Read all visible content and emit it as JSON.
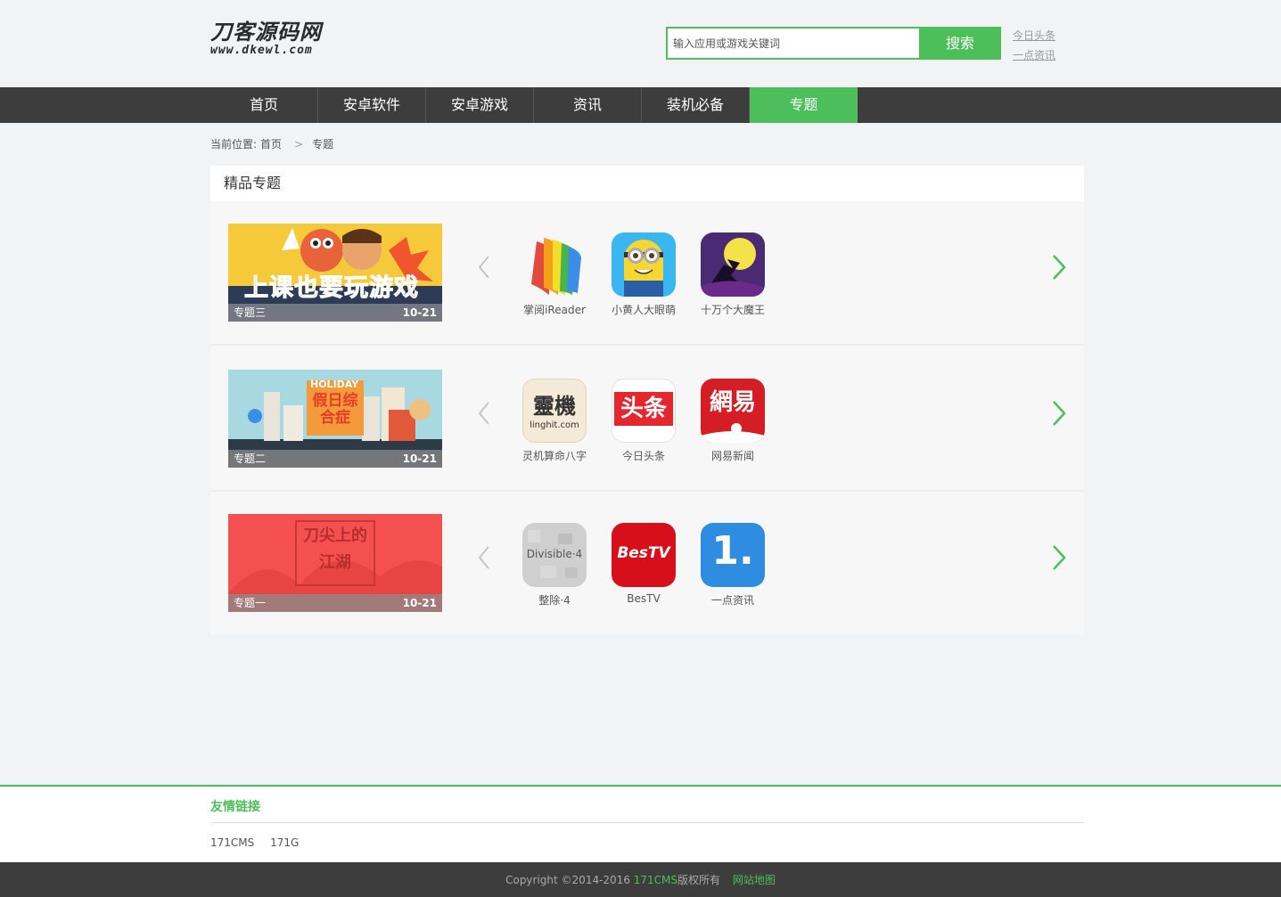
{
  "header": {
    "logo_text": "刀客源码网",
    "logo_url_text": "www.dkewl.com",
    "search_placeholder": "输入应用或游戏关键词",
    "search_button": "搜索",
    "hot_links": [
      "今日头条",
      "一点资讯"
    ]
  },
  "nav": {
    "items": [
      "首页",
      "安卓软件",
      "安卓游戏",
      "资讯",
      "装机必备",
      "专题"
    ],
    "active_index": 5
  },
  "breadcrumb": {
    "prefix": "当前位置:",
    "home": "首页",
    "separator": ">",
    "current": "专题"
  },
  "panel": {
    "title": "精品专题",
    "topics": [
      {
        "banner_text": "上课也要玩游戏",
        "name": "专题三",
        "date": "10-21",
        "apps": [
          {
            "name": "掌阅iReader",
            "icon": "ireader-book-icon"
          },
          {
            "name": "小黄人大眼萌",
            "icon": "minion-icon"
          },
          {
            "name": "十万个大魔王",
            "icon": "ninja-moon-icon"
          }
        ]
      },
      {
        "banner_text_top": "HOLIDAY",
        "banner_text": "假日综合症",
        "name": "专题二",
        "date": "10-21",
        "apps": [
          {
            "name": "灵机算命八字",
            "icon": "linghit-icon",
            "icon_text": "靈機",
            "icon_sub": "linghit.com"
          },
          {
            "name": "今日头条",
            "icon": "toutiao-icon",
            "icon_text": "头条"
          },
          {
            "name": "网易新闻",
            "icon": "netease-news-icon",
            "icon_text": "網易"
          }
        ]
      },
      {
        "banner_text": "刀尖上的江湖",
        "name": "专题一",
        "date": "10-21",
        "apps": [
          {
            "name": "整除·4",
            "icon": "divisible-icon",
            "icon_text": "Divisible·4"
          },
          {
            "name": "BesTV",
            "icon": "bestv-icon",
            "icon_text": "BesTV"
          },
          {
            "name": "一点资讯",
            "icon": "yidian-icon",
            "icon_text": "1."
          }
        ]
      }
    ]
  },
  "footer": {
    "friends_title": "友情链接",
    "friends_links": [
      "171CMS",
      "171G"
    ],
    "copyright_prefix": "Copyright ©2014-2016 ",
    "copyright_brand": "171CMS",
    "copyright_suffix": "版权所有",
    "sitemap": "网站地图"
  },
  "colors": {
    "accent": "#4cbe5a",
    "nav_bg": "#3d3d3d",
    "page_bg": "#f2f3f4"
  }
}
